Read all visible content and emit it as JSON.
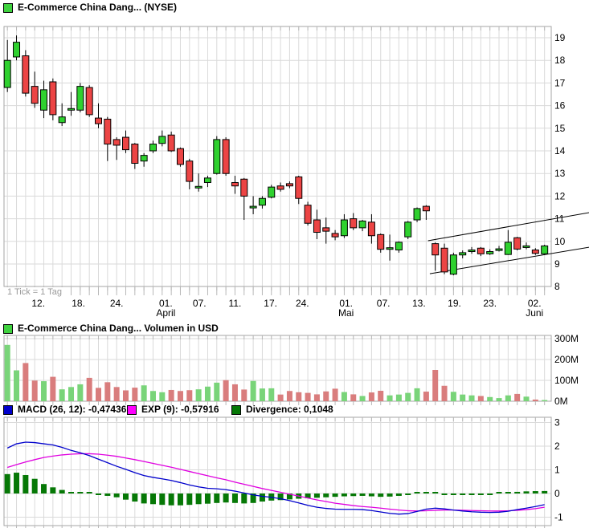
{
  "header": {
    "swatch_color": "#3fd23f",
    "title": "E-Commerce China Dang... (NYSE)"
  },
  "tick_note": "1 Tick = 1 Tag",
  "volume_header": {
    "swatch_color": "#3fd23f",
    "title": "E-Commerce China Dang... Volumen in USD"
  },
  "macd_legend": {
    "items": [
      {
        "swatch_color": "#0000cc",
        "label": "MACD (26, 12): -0,47436"
      },
      {
        "swatch_color": "#ff00ff",
        "label": "EXP (9): -0,57916"
      },
      {
        "swatch_color": "#067806",
        "label": "Divergence: 0,1048"
      }
    ]
  },
  "colors": {
    "candle_up": "#2fd12f",
    "candle_down": "#ec4444",
    "candle_border": "#000000",
    "volume_up": "#79d479",
    "volume_down": "#d97d7d",
    "macd_line": "#0000cc",
    "exp_line": "#e000e0",
    "divergence_bar": "#067806",
    "grid": "#dadada",
    "panel_border": "#a6a6a6",
    "tick": "#b8b8b8",
    "trendline": "#000000",
    "axis_text": "#000000"
  },
  "chart_data": [
    {
      "type": "candlestick",
      "title": "E-Commerce China Dang... (NYSE)",
      "note": "1 Tick = 1 Tag",
      "ylim": [
        8,
        19.5
      ],
      "yticks": [
        8,
        9,
        10,
        11,
        12,
        13,
        14,
        15,
        16,
        17,
        18,
        19
      ],
      "x_labels": [
        {
          "t": "12.",
          "xi": 3.4
        },
        {
          "t": "18.",
          "xi": 7.8
        },
        {
          "t": "24.",
          "xi": 12.0
        },
        {
          "t": "01.",
          "m": "April",
          "xi": 17.4
        },
        {
          "t": "07.",
          "xi": 21.1
        },
        {
          "t": "11.",
          "xi": 25.0
        },
        {
          "t": "17.",
          "xi": 28.9
        },
        {
          "t": "24.",
          "xi": 32.4
        },
        {
          "t": "01.",
          "m": "Mai",
          "xi": 37.2
        },
        {
          "t": "07.",
          "xi": 41.3
        },
        {
          "t": "13.",
          "xi": 45.2
        },
        {
          "t": "19.",
          "xi": 49.1
        },
        {
          "t": "23.",
          "xi": 53.0
        },
        {
          "t": "02.",
          "m": "Juni",
          "xi": 57.9
        }
      ],
      "ohlc": [
        [
          16.8,
          18.9,
          16.6,
          18.0
        ],
        [
          18.15,
          19.1,
          18.0,
          18.8
        ],
        [
          18.2,
          18.45,
          16.4,
          16.55
        ],
        [
          16.85,
          17.5,
          15.9,
          16.1
        ],
        [
          15.8,
          17.1,
          15.45,
          16.7
        ],
        [
          17.05,
          17.2,
          15.35,
          15.6
        ],
        [
          15.25,
          16.1,
          15.1,
          15.5
        ],
        [
          15.85,
          16.6,
          15.55,
          15.87
        ],
        [
          15.8,
          17.0,
          15.7,
          16.85
        ],
        [
          16.8,
          16.9,
          15.5,
          15.6
        ],
        [
          15.45,
          16.1,
          15.0,
          15.2
        ],
        [
          15.4,
          15.5,
          13.55,
          14.3
        ],
        [
          14.5,
          14.6,
          13.6,
          14.25
        ],
        [
          14.6,
          14.9,
          13.9,
          14.05
        ],
        [
          14.3,
          14.35,
          13.2,
          13.45
        ],
        [
          13.55,
          13.9,
          13.3,
          13.8
        ],
        [
          14.0,
          14.45,
          13.9,
          14.3
        ],
        [
          14.33,
          14.9,
          14.2,
          14.64
        ],
        [
          14.7,
          14.85,
          13.95,
          14.0
        ],
        [
          14.1,
          14.15,
          13.3,
          13.4
        ],
        [
          13.55,
          13.65,
          12.3,
          12.65
        ],
        [
          12.4,
          13.0,
          12.2,
          12.43
        ],
        [
          12.6,
          12.9,
          12.4,
          12.8
        ],
        [
          13.0,
          14.65,
          12.95,
          14.5
        ],
        [
          14.5,
          14.6,
          12.9,
          13.0
        ],
        [
          12.6,
          12.9,
          12.1,
          12.45
        ],
        [
          12.75,
          12.8,
          10.95,
          12.0
        ],
        [
          11.5,
          12.0,
          11.2,
          11.55
        ],
        [
          11.6,
          12.0,
          11.45,
          11.9
        ],
        [
          11.95,
          12.5,
          11.9,
          12.4
        ],
        [
          12.45,
          12.6,
          12.2,
          12.3
        ],
        [
          12.55,
          12.65,
          12.35,
          12.45
        ],
        [
          12.85,
          12.9,
          11.65,
          11.9
        ],
        [
          11.6,
          11.75,
          10.7,
          10.8
        ],
        [
          10.95,
          11.4,
          10.1,
          10.4
        ],
        [
          10.6,
          11.05,
          9.9,
          10.45
        ],
        [
          10.35,
          10.5,
          10.05,
          10.2
        ],
        [
          10.25,
          11.2,
          10.15,
          10.95
        ],
        [
          11.0,
          11.25,
          10.5,
          10.6
        ],
        [
          10.6,
          10.95,
          10.45,
          10.9
        ],
        [
          10.85,
          11.2,
          9.9,
          10.25
        ],
        [
          10.3,
          10.35,
          9.5,
          9.65
        ],
        [
          9.7,
          10.3,
          9.15,
          9.72
        ],
        [
          9.62,
          10.0,
          9.5,
          9.96
        ],
        [
          10.2,
          10.9,
          10.1,
          10.85
        ],
        [
          10.95,
          11.5,
          10.85,
          11.45
        ],
        [
          11.55,
          11.6,
          10.95,
          11.35
        ],
        [
          9.9,
          9.95,
          8.7,
          9.4
        ],
        [
          9.7,
          9.9,
          8.55,
          8.65
        ],
        [
          8.55,
          9.5,
          8.5,
          9.4
        ],
        [
          9.4,
          9.6,
          9.25,
          9.5
        ],
        [
          9.6,
          9.75,
          9.45,
          9.62
        ],
        [
          9.7,
          9.75,
          9.35,
          9.45
        ],
        [
          9.45,
          9.65,
          9.4,
          9.55
        ],
        [
          9.65,
          9.8,
          9.55,
          9.67
        ],
        [
          9.42,
          10.5,
          9.4,
          9.96
        ],
        [
          10.16,
          10.2,
          9.6,
          9.66
        ],
        [
          9.78,
          9.95,
          9.65,
          9.8
        ],
        [
          9.62,
          9.7,
          9.4,
          9.47
        ],
        [
          9.45,
          9.85,
          9.4,
          9.8
        ]
      ],
      "trendlines": [
        {
          "i1": 46.2,
          "p1": 10.03,
          "i2": 63.9,
          "p2": 11.27
        },
        {
          "i1": 46.4,
          "p1": 8.57,
          "i2": 63.9,
          "p2": 9.74
        }
      ]
    },
    {
      "type": "bar",
      "title": "E-Commerce China Dang... Volumen in USD",
      "yticks": [
        {
          "v": 0,
          "t": "0M"
        },
        {
          "v": 100,
          "t": "100M"
        },
        {
          "v": 200,
          "t": "200M"
        },
        {
          "v": 300,
          "t": "300M"
        }
      ],
      "values_millions": [
        270,
        148,
        183,
        99,
        96,
        117,
        57,
        68,
        81,
        112,
        64,
        91,
        68,
        52,
        65,
        76,
        49,
        43,
        54,
        49,
        53,
        57,
        70,
        89,
        101,
        81,
        56,
        97,
        61,
        62,
        32,
        49,
        43,
        40,
        33,
        47,
        60,
        44,
        33,
        25,
        42,
        50,
        28,
        32,
        40,
        62,
        46,
        150,
        74,
        45,
        32,
        28,
        25,
        20,
        15,
        28,
        35,
        22,
        8,
        5
      ]
    },
    {
      "type": "macd",
      "yticks": [
        -1,
        0,
        1,
        2,
        3
      ],
      "series": [
        {
          "name": "MACD (26, 12)",
          "value_label": "-0,47436",
          "style": "line",
          "color": "#0000cc",
          "values": [
            1.92,
            2.1,
            2.17,
            2.15,
            2.1,
            2.05,
            1.95,
            1.82,
            1.72,
            1.6,
            1.45,
            1.3,
            1.15,
            1.02,
            0.88,
            0.76,
            0.68,
            0.62,
            0.55,
            0.46,
            0.36,
            0.28,
            0.22,
            0.2,
            0.16,
            0.1,
            0.02,
            -0.06,
            -0.12,
            -0.16,
            -0.22,
            -0.3,
            -0.4,
            -0.5,
            -0.58,
            -0.63,
            -0.66,
            -0.67,
            -0.67,
            -0.68,
            -0.72,
            -0.78,
            -0.84,
            -0.87,
            -0.85,
            -0.76,
            -0.66,
            -0.62,
            -0.65,
            -0.7,
            -0.74,
            -0.77,
            -0.79,
            -0.8,
            -0.79,
            -0.75,
            -0.68,
            -0.62,
            -0.55,
            -0.47
          ]
        },
        {
          "name": "EXP (9)",
          "value_label": "-0,57916",
          "style": "line",
          "color": "#e000e0",
          "values": [
            1.1,
            1.22,
            1.33,
            1.43,
            1.52,
            1.58,
            1.63,
            1.66,
            1.68,
            1.68,
            1.66,
            1.62,
            1.57,
            1.5,
            1.43,
            1.35,
            1.27,
            1.19,
            1.11,
            1.02,
            0.93,
            0.84,
            0.75,
            0.66,
            0.58,
            0.48,
            0.39,
            0.3,
            0.21,
            0.13,
            0.05,
            -0.03,
            -0.11,
            -0.19,
            -0.27,
            -0.34,
            -0.41,
            -0.46,
            -0.51,
            -0.55,
            -0.58,
            -0.62,
            -0.66,
            -0.7,
            -0.73,
            -0.74,
            -0.73,
            -0.71,
            -0.7,
            -0.7,
            -0.71,
            -0.72,
            -0.73,
            -0.74,
            -0.74,
            -0.73,
            -0.71,
            -0.68,
            -0.64,
            -0.58
          ]
        },
        {
          "name": "Divergence",
          "value_label": "0,1048",
          "style": "histogram",
          "color": "#067806",
          "values": [
            0.82,
            0.88,
            0.78,
            0.62,
            0.4,
            0.26,
            0.15,
            0.06,
            0.03,
            0.02,
            -0.04,
            -0.1,
            -0.16,
            -0.26,
            -0.34,
            -0.42,
            -0.45,
            -0.48,
            -0.5,
            -0.5,
            -0.48,
            -0.45,
            -0.43,
            -0.4,
            -0.38,
            -0.4,
            -0.42,
            -0.4,
            -0.34,
            -0.3,
            -0.28,
            -0.25,
            -0.22,
            -0.2,
            -0.18,
            -0.16,
            -0.14,
            -0.12,
            -0.11,
            -0.1,
            -0.12,
            -0.14,
            -0.13,
            -0.1,
            -0.05,
            0.03,
            0.06,
            0.02,
            -0.04,
            -0.06,
            -0.06,
            -0.05,
            -0.04,
            -0.02,
            0.0,
            0.04,
            0.07,
            0.09,
            0.1,
            0.105
          ]
        }
      ]
    }
  ]
}
